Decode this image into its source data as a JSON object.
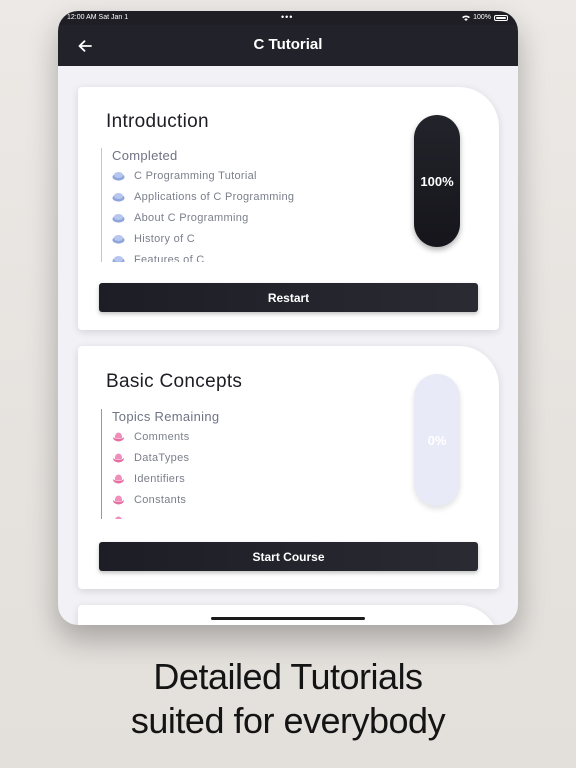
{
  "status_bar": {
    "time": "12:00 AM   Sat Jan 1",
    "dots": "•••",
    "battery": "100%"
  },
  "nav": {
    "title": "C Tutorial"
  },
  "cards": [
    {
      "title": "Introduction",
      "heading": "Completed",
      "progress_label": "100%",
      "progress": 1.0,
      "button": "Restart",
      "topics": [
        "C Programming Tutorial",
        "Applications of C Programming",
        "About C Programming",
        "History of C",
        "Features of C"
      ]
    },
    {
      "title": "Basic Concepts",
      "heading": "Topics Remaining",
      "progress_label": "0%",
      "progress": 0.0,
      "button": "Start Course",
      "topics": [
        "Comments",
        "DataTypes",
        "Identifiers",
        "Constants"
      ]
    }
  ],
  "colors": {
    "completed_bullet": "#8fa6dc",
    "remaining_bullet": "#e46fa0",
    "dark": "#1d1d25",
    "pill_empty": "#e8eaf8"
  },
  "caption": {
    "line1": "Detailed Tutorials",
    "line2": "suited for everybody"
  }
}
